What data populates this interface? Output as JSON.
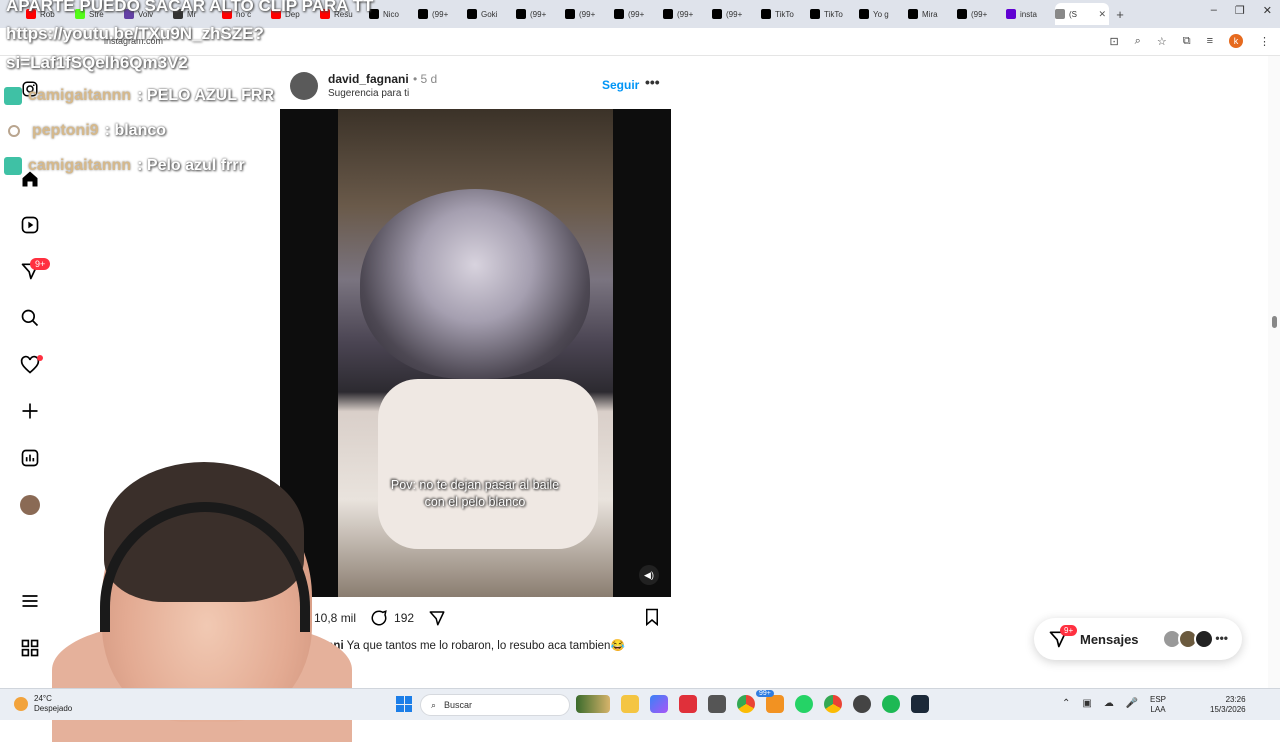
{
  "browser": {
    "tabs": [
      {
        "label": "Rob",
        "color": "#ff0000"
      },
      {
        "label": "Stre",
        "color": "#53fc18"
      },
      {
        "label": "Volv",
        "color": "#6441a5"
      },
      {
        "label": "Mr",
        "color": "#333333"
      },
      {
        "label": "no c",
        "color": "#ff0000"
      },
      {
        "label": "Dep",
        "color": "#ff0000"
      },
      {
        "label": "Resu",
        "color": "#ff0000"
      },
      {
        "label": "Nico",
        "color": "#000000"
      },
      {
        "label": "(99+",
        "color": "#000000"
      },
      {
        "label": "Goki",
        "color": "#000000"
      },
      {
        "label": "(99+",
        "color": "#000000"
      },
      {
        "label": "(99+",
        "color": "#000000"
      },
      {
        "label": "(99+",
        "color": "#000000"
      },
      {
        "label": "(99+",
        "color": "#000000"
      },
      {
        "label": "(99+",
        "color": "#000000"
      },
      {
        "label": "TikTo",
        "color": "#000000"
      },
      {
        "label": "TikTo",
        "color": "#000000"
      },
      {
        "label": "Yo g",
        "color": "#000000"
      },
      {
        "label": "Mira",
        "color": "#000000"
      },
      {
        "label": "(99+",
        "color": "#000000"
      },
      {
        "label": "insta",
        "color": "#6001d2"
      },
      {
        "label": "(S",
        "color": "#888888"
      }
    ],
    "url": "instagram.com"
  },
  "overlay": {
    "line1": "APARTE PUEDO SACAR ALTO CLIP PARA TT",
    "line2": "https://youtu.be/TXu9N_zhSZE?",
    "line3": "si=Laf1fSQelh6Qm3V2"
  },
  "chat": [
    {
      "user": "camigaitannn",
      "message": ": PELO AZUL FRR"
    },
    {
      "user": "peptoni9",
      "message": ": blanco"
    },
    {
      "user": "camigaitannn",
      "message": ": Pelo azul frrr"
    }
  ],
  "sidebar": {
    "notifications_badge": "9+"
  },
  "post": {
    "username": "david_fagnani",
    "time": "• 5 d",
    "subtitle": "Sugerencia para ti",
    "follow_label": "Seguir",
    "video_caption": "Pov: no te dejan pasar al baile con el pelo blanco",
    "likes": "10,8 mil",
    "comments": "192",
    "caption_user": "nani",
    "caption_text": "Ya que tantos me lo robaron, lo resubo aca tambien😂"
  },
  "messages": {
    "label": "Mensajes",
    "badge": "9+"
  },
  "taskbar": {
    "weather_temp": "24°C",
    "weather_desc": "Despejado",
    "search_placeholder": "Buscar",
    "tray_badge": "99+",
    "lang_line1": "ESP",
    "lang_line2": "LAA",
    "time": "23:26",
    "date": "15/3/2026"
  }
}
